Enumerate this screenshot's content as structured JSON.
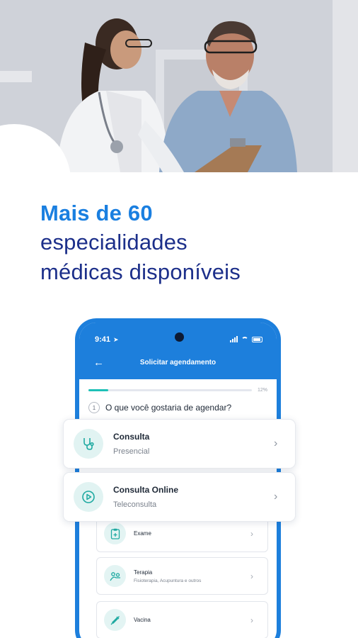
{
  "headline": {
    "accent": "Mais de 60",
    "line2": "especialidades",
    "line3": "médicas disponíveis"
  },
  "phone": {
    "status_time": "9:41",
    "title": "Solicitar agendamento",
    "progress_label": "12%",
    "progress_value": 0.12,
    "question_number": "1",
    "question": "O que você gostaria de agendar?"
  },
  "options": [
    {
      "title": "Consulta",
      "subtitle": "Presencial",
      "icon": "stethoscope-icon"
    },
    {
      "title": "Consulta Online",
      "subtitle": "Teleconsulta",
      "icon": "video-play-icon"
    },
    {
      "title": "Exame",
      "subtitle": "",
      "icon": "clipboard-icon"
    },
    {
      "title": "Terapia",
      "subtitle": "Fisioterapia, Acupuntura e outros",
      "icon": "therapy-icon"
    },
    {
      "title": "Vacina",
      "subtitle": "",
      "icon": "syringe-icon"
    }
  ],
  "colors": {
    "brand_blue": "#1d7fdc",
    "accent_blue": "#1a7fe0",
    "headline_dark": "#1c2f8a",
    "teal": "#1ec0b7"
  }
}
